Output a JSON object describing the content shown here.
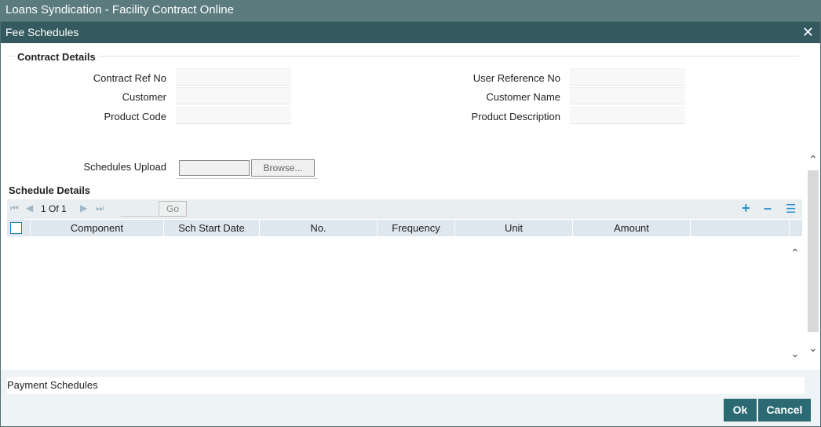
{
  "window": {
    "title": "Loans Syndication - Facility Contract Online"
  },
  "dialog": {
    "title": "Fee Schedules",
    "close_icon": "✕"
  },
  "contract_details": {
    "title": "Contract Details",
    "contract_ref_no": {
      "label": "Contract Ref No",
      "value": ""
    },
    "customer": {
      "label": "Customer",
      "value": ""
    },
    "product_code": {
      "label": "Product Code",
      "value": ""
    },
    "user_reference_no": {
      "label": "User Reference No",
      "value": ""
    },
    "customer_name": {
      "label": "Customer Name",
      "value": ""
    },
    "product_description": {
      "label": "Product Description",
      "value": ""
    }
  },
  "upload": {
    "label": "Schedules Upload",
    "browse_label": "Browse..."
  },
  "schedule_details": {
    "title": "Schedule Details",
    "pager": {
      "info": "1 Of 1",
      "go_label": "Go"
    },
    "columns": [
      "Component",
      "Sch Start Date",
      "No.",
      "Frequency",
      "Unit",
      "Amount"
    ]
  },
  "payment_schedules": {
    "label": "Payment Schedules"
  },
  "buttons": {
    "ok": "Ok",
    "cancel": "Cancel"
  }
}
